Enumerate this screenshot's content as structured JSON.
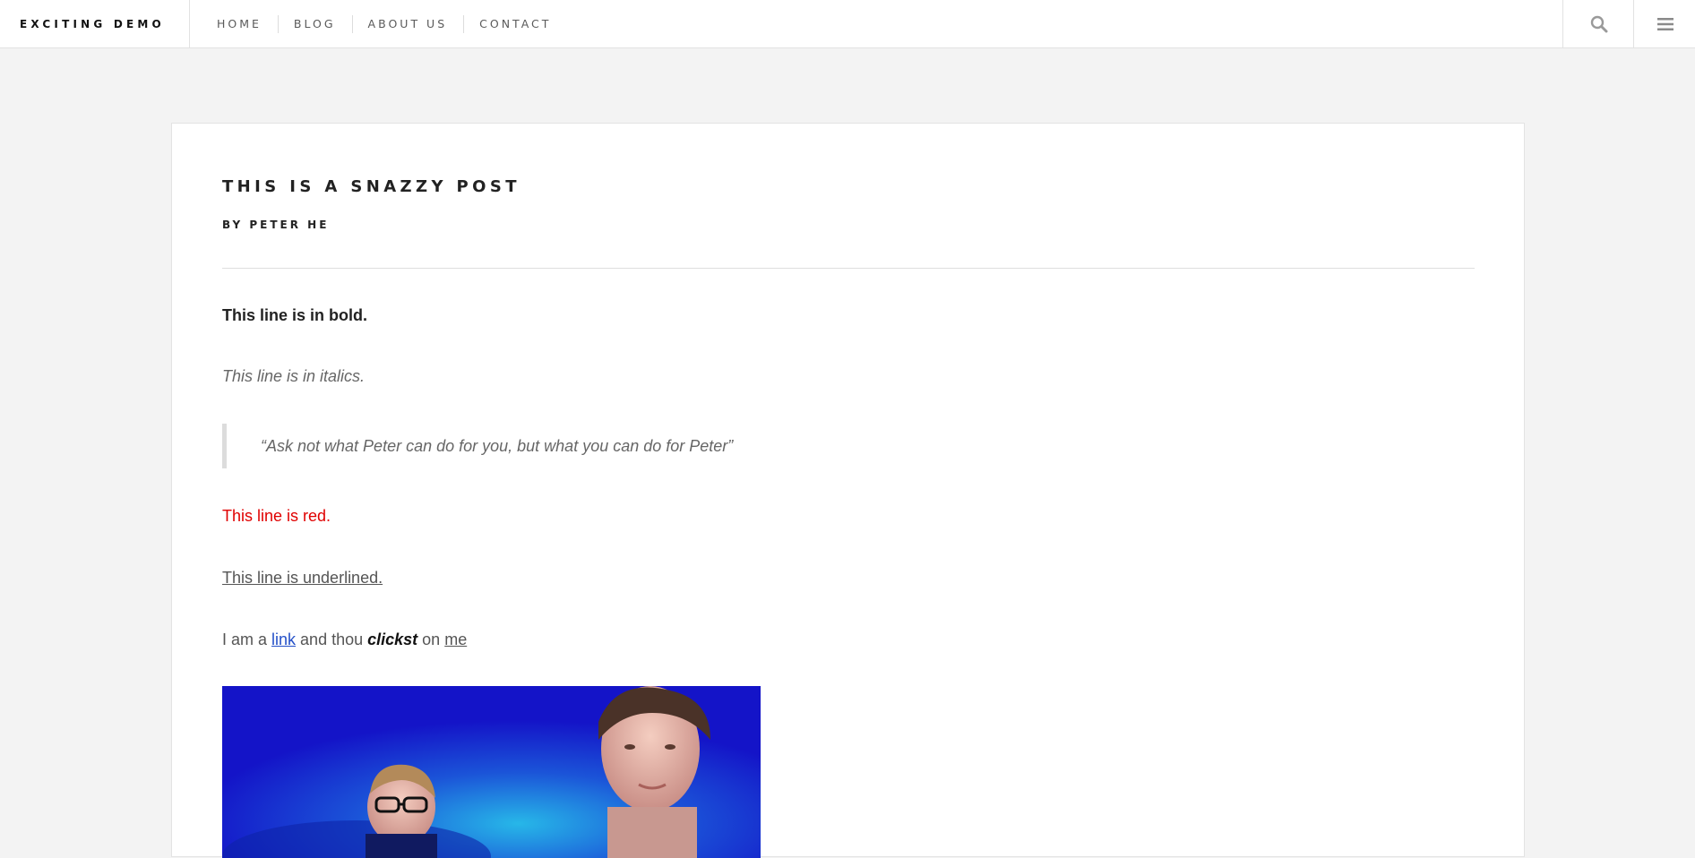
{
  "nav": {
    "brand": "EXCITING DEMO",
    "items": [
      {
        "label": "HOME"
      },
      {
        "label": "BLOG"
      },
      {
        "label": "ABOUT US"
      },
      {
        "label": "CONTACT"
      }
    ],
    "search_icon": "search-icon",
    "menu_icon": "hamburger-menu-icon"
  },
  "post": {
    "title": "THIS IS A SNAZZY POST",
    "author": "BY PETER HE",
    "bold_line": "This line is in bold.",
    "italic_line": "This line is in italics.",
    "quote": "“Ask not what Peter can do for you, but what you can do for Peter”",
    "red_line": "This line is red.",
    "red_color": "#e00000",
    "underlined_line": "This line is underlined.",
    "link_sentence": {
      "prefix": "I am a ",
      "link_text": "link",
      "middle": " and thou ",
      "emphasis": "clickst",
      "after": " on ",
      "me_text": "me"
    }
  },
  "colors": {
    "link": "#2450c8",
    "background": "#f3f3f3"
  }
}
